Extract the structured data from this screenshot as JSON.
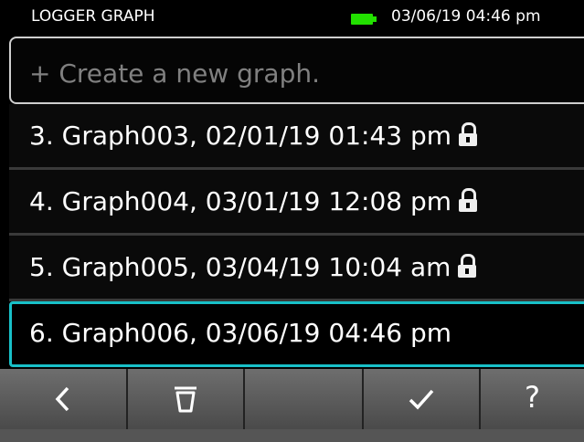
{
  "header": {
    "title": "LOGGER GRAPH",
    "datetime": "03/06/19 04:46 pm",
    "battery_color": "#22e000"
  },
  "list": {
    "create_label": "+ Create a new graph.",
    "items": [
      {
        "label": "3. Graph003, 02/01/19 01:43 pm",
        "locked": true,
        "selected": false
      },
      {
        "label": "4. Graph004, 03/01/19 12:08 pm",
        "locked": true,
        "selected": false
      },
      {
        "label": "5. Graph005, 03/04/19 10:04 am",
        "locked": true,
        "selected": false
      },
      {
        "label": "6. Graph006, 03/06/19 04:46 pm",
        "locked": false,
        "selected": true
      }
    ],
    "selected_border_color": "#18c0c8"
  },
  "toolbar": {
    "buttons": [
      {
        "icon": "back-chevron-icon"
      },
      {
        "icon": "trash-icon"
      },
      {
        "icon": ""
      },
      {
        "icon": "checkmark-icon"
      },
      {
        "icon": "help-icon",
        "label": "?"
      }
    ]
  }
}
